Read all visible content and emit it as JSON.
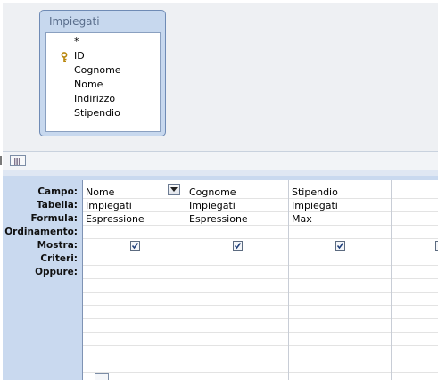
{
  "table": {
    "title": "Impiegati",
    "fields": [
      "*",
      "ID",
      "Cognome",
      "Nome",
      "Indirizzo",
      "Stipendio"
    ],
    "key_field": "ID",
    "key_icon": "key-icon"
  },
  "grid": {
    "row_labels": [
      "Campo:",
      "Tabella:",
      "Formula:",
      "Ordinamento:",
      "Mostra:",
      "Criteri:",
      "Oppure:"
    ],
    "columns": [
      {
        "campo": "Nome",
        "tabella": "Impiegati",
        "formula": "Espressione",
        "ordinamento": "",
        "mostra": true
      },
      {
        "campo": "Cognome",
        "tabella": "Impiegati",
        "formula": "Espressione",
        "ordinamento": "",
        "mostra": true
      },
      {
        "campo": "Stipendio",
        "tabella": "Impiegati",
        "formula": "Max",
        "ordinamento": "",
        "mostra": true
      },
      {
        "campo": "",
        "tabella": "",
        "formula": "",
        "ordinamento": "",
        "mostra": true
      }
    ]
  },
  "colors": {
    "table_box_bg": "#c7d8ee",
    "lower_pane_bg": "#c9d9ef",
    "upper_pane_bg": "#eef0f3"
  }
}
